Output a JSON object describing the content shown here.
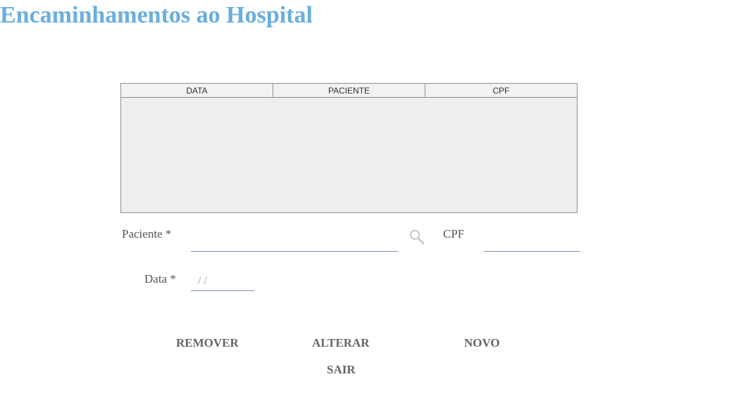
{
  "page": {
    "title": "Encaminhamentos ao Hospital"
  },
  "table": {
    "columns": [
      "DATA",
      "PACIENTE",
      "CPF"
    ],
    "rows": []
  },
  "form": {
    "paciente_label": "Paciente *",
    "paciente_value": "",
    "cpf_label": "CPF",
    "cpf_value": "",
    "data_label": "Data *",
    "data_value": "/ /"
  },
  "icons": {
    "search": "search-icon"
  },
  "buttons": {
    "remover": "REMOVER",
    "alterar": "ALTERAR",
    "novo": "NOVO",
    "sair": "SAIR"
  },
  "colors": {
    "title": "#6aaede",
    "grid_bg": "#eeeeee",
    "grid_border": "#8a9099",
    "input_underline": "#7d8fa6",
    "button_text": "#666666"
  }
}
